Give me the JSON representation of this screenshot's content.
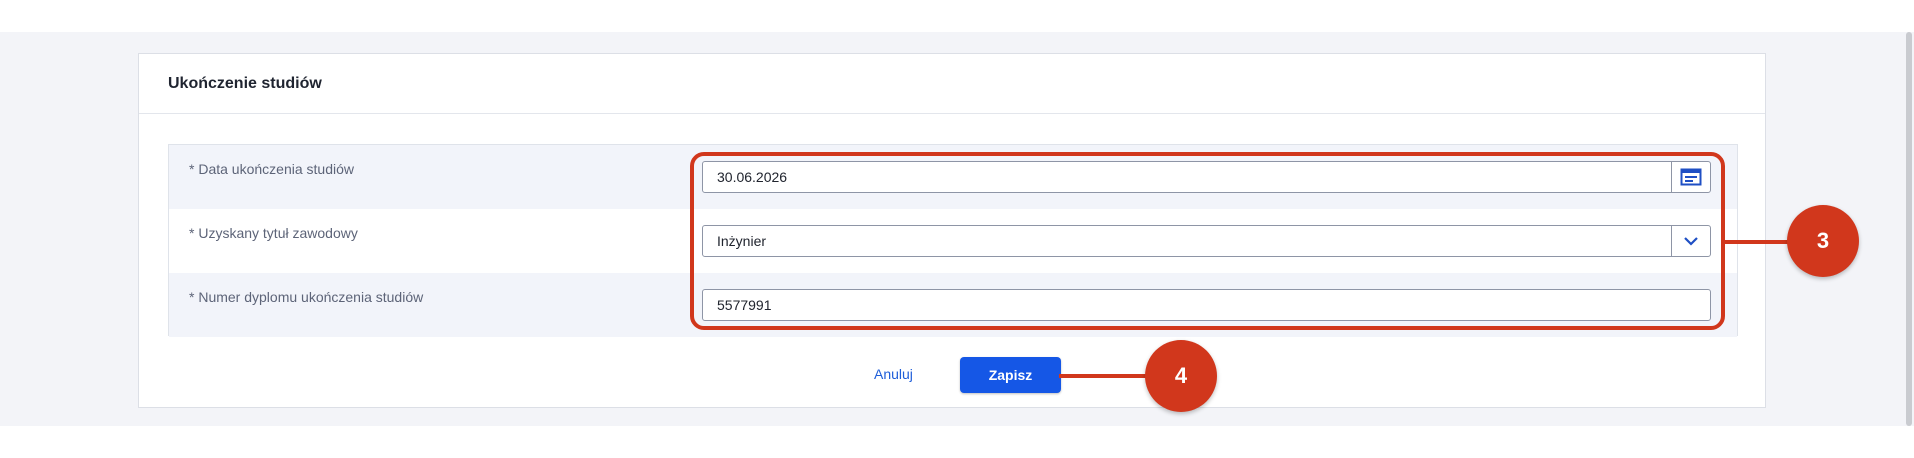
{
  "card": {
    "title": "Ukończenie studiów"
  },
  "form": {
    "rows": [
      {
        "label": "* Data ukończenia studiów",
        "value": "30.06.2026",
        "control": "date",
        "icon": "calendar-icon"
      },
      {
        "label": "* Uzyskany tytuł zawodowy",
        "value": "Inżynier",
        "control": "select",
        "icon": "chevron-down-icon"
      },
      {
        "label": "* Numer dyplomu ukończenia studiów",
        "value": "5577991",
        "control": "text"
      }
    ]
  },
  "actions": {
    "cancel_label": "Anuluj",
    "save_label": "Zapisz"
  },
  "annotations": {
    "fields_step": "3",
    "save_step": "4"
  },
  "colors": {
    "accent": "#1557e6",
    "annotation": "#d1371c",
    "page_background": "#f3f4f8"
  }
}
